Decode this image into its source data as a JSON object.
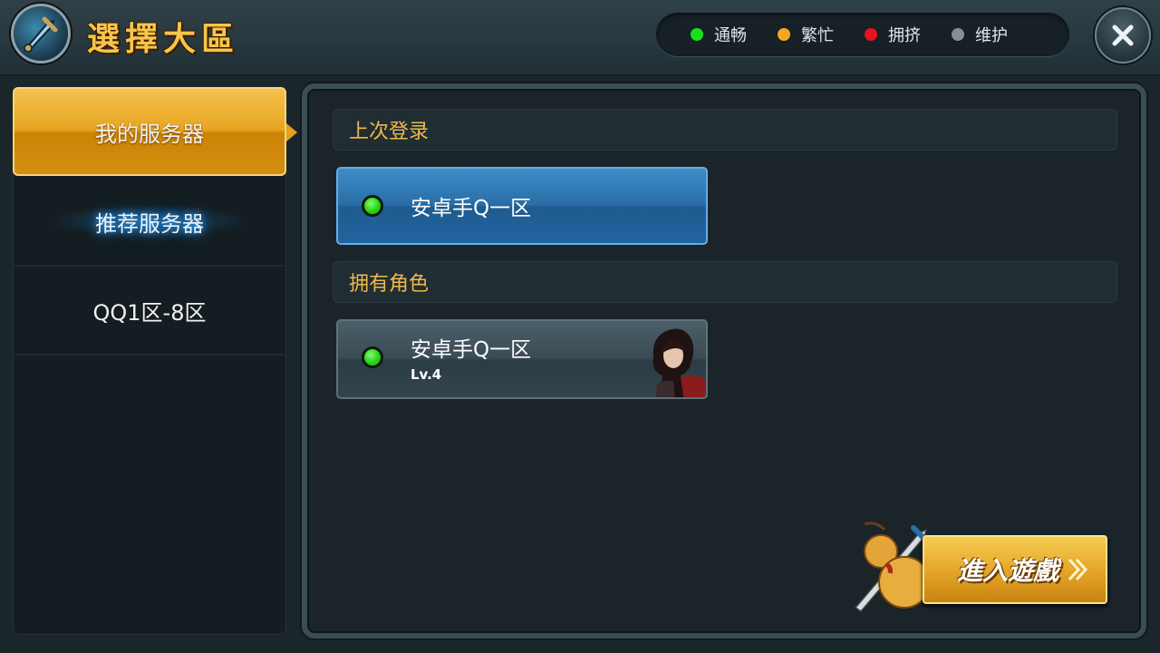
{
  "header": {
    "title": "選擇大區",
    "legend": [
      {
        "label": "通畅",
        "color": "#17e31a"
      },
      {
        "label": "繁忙",
        "color": "#f5a623"
      },
      {
        "label": "拥挤",
        "color": "#e8141a"
      },
      {
        "label": "维护",
        "color": "#8a8d8e"
      }
    ],
    "close_icon": "close-x-icon"
  },
  "sidebar": {
    "items": [
      {
        "label": "我的服务器",
        "state": "selected"
      },
      {
        "label": "推荐服务器",
        "state": "highlighted"
      },
      {
        "label": "QQ1区-8区",
        "state": "normal"
      }
    ]
  },
  "main": {
    "last_login": {
      "heading": "上次登录",
      "server": {
        "name": "安卓手Q一区",
        "status": "通畅"
      }
    },
    "owned_roles": {
      "heading": "拥有角色",
      "server": {
        "name": "安卓手Q一区",
        "level": "Lv.4",
        "status": "通畅"
      }
    }
  },
  "enter_button": {
    "label": "進入遊戲",
    "icon": "double-chevron-right-icon"
  },
  "colors": {
    "accent_gold": "#e6a72a",
    "selected_blue": "#2a6ea6",
    "title_gold": "#f6c54a"
  }
}
